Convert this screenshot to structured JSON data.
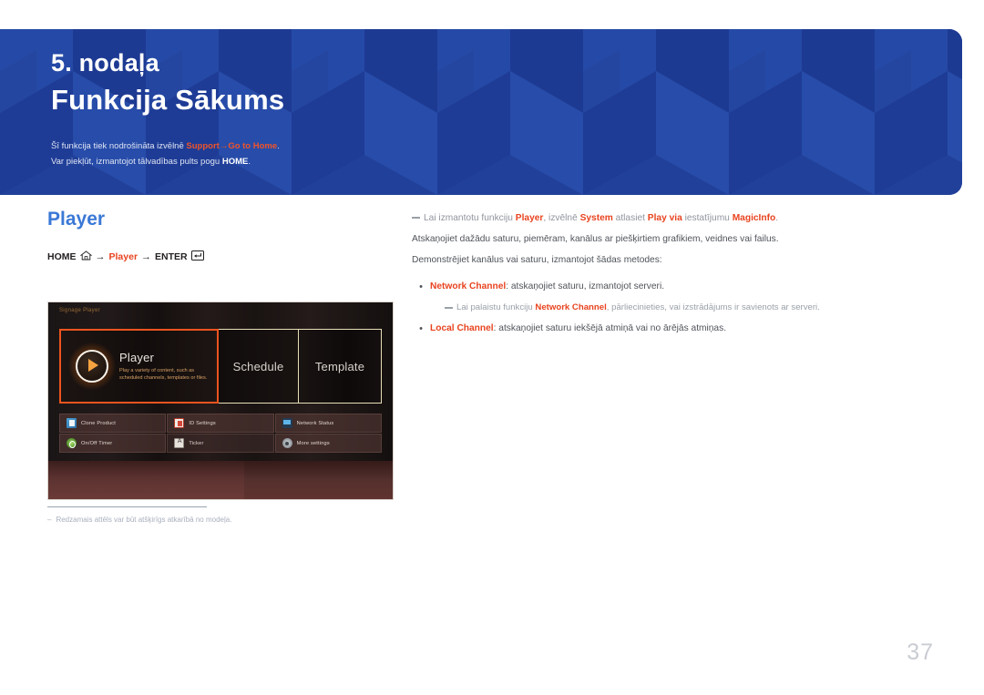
{
  "banner": {
    "chapter_label": "5. nodaļa",
    "chapter_title": "Funkcija Sākums",
    "note_line1_pre": "Šī funkcija tiek nodrošināta izvēlnē ",
    "note_line1_accent1": "Support",
    "note_line1_arrow": "→",
    "note_line1_accent2": "Go to Home",
    "note_line1_post": ".",
    "note_line2_pre": "Var piekļūt, izmantojot tālvadības pults pogu ",
    "note_line2_bold": "HOME",
    "note_line2_post": ".",
    "bg_color": "#21409a",
    "accent_color": "#f0542a"
  },
  "left": {
    "section_title": "Player",
    "nav": {
      "home_label": "HOME",
      "home_icon": "home-icon",
      "arrow1": "→",
      "player_label": "Player",
      "arrow2": "→",
      "enter_label": "ENTER",
      "enter_icon": "enter-key-icon"
    },
    "tv": {
      "signage_label": "Signage Player",
      "tiles": [
        {
          "name": "Player",
          "subtitle": "Play a variety of content, such as scheduled channels, templates or files.",
          "selected": true,
          "icon": "play-circle-icon"
        },
        {
          "name": "Schedule",
          "subtitle": "",
          "selected": false,
          "icon": ""
        },
        {
          "name": "Template",
          "subtitle": "",
          "selected": false,
          "icon": ""
        }
      ],
      "quick_items": [
        {
          "label": "Clone Product",
          "icon": "clone-product-icon"
        },
        {
          "label": "ID Settings",
          "icon": "id-settings-icon"
        },
        {
          "label": "Network Status",
          "icon": "network-status-icon"
        },
        {
          "label": "On/Off Timer",
          "icon": "on-off-timer-icon"
        },
        {
          "label": "Ticker",
          "icon": "ticker-icon"
        },
        {
          "label": "More settings",
          "icon": "more-settings-icon"
        }
      ]
    },
    "footnote": {
      "dash": "‒",
      "text": "Redzamais attēls var būt atšķirīgs atkarībā no modeļa."
    }
  },
  "right": {
    "note1": {
      "part1": "Lai izmantotu funkciju ",
      "bold1": "Player",
      "part2": ", izvēlnē ",
      "bold2": "System",
      "part3": " atlasiet ",
      "bold3": "Play via",
      "part4": " iestatījumu ",
      "bold4": "MagicInfo",
      "part5": "."
    },
    "para1": "Atskaņojiet dažādu saturu, piemēram, kanālus ar piešķirtiem grafikiem, veidnes vai failus.",
    "para2": "Demonstrējiet kanālus vai saturu, izmantojot šādas metodes:",
    "bullet1": {
      "dot": "•",
      "bold": "Network Channel",
      "text": ": atskaņojiet saturu, izmantojot serveri."
    },
    "subnote1": {
      "part1": "Lai palaistu funkciju ",
      "bold1": "Network Channel",
      "part2": ", pārliecinieties, vai izstrādājums ir savienots ar serveri."
    },
    "bullet2": {
      "dot": "•",
      "bold": "Local Channel",
      "text": ": atskaņojiet saturu iekšējā atmiņā vai no ārējās atmiņas."
    }
  },
  "page_number": "37"
}
